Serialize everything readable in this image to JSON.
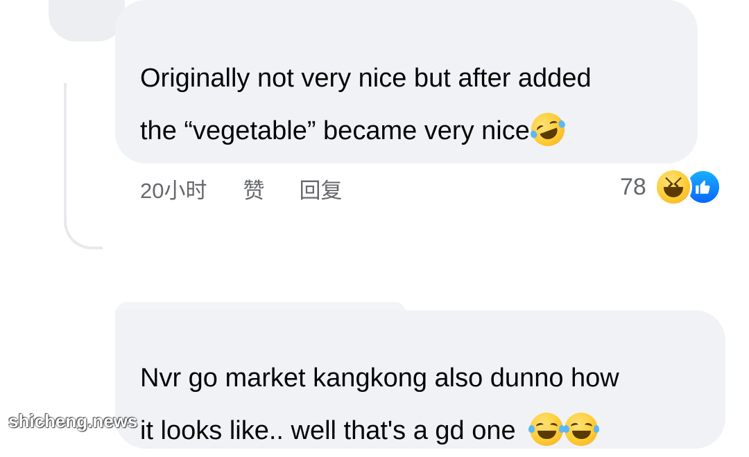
{
  "comments": [
    {
      "lines": [
        "Originally not very nice but after added",
        "the “vegetable” became very nice"
      ],
      "trailing_emoji": "rolling-on-floor-laughing-icon",
      "meta": {
        "time": "20小时",
        "like_label": "赞",
        "reply_label": "回复"
      },
      "reactions": {
        "count": "78",
        "icons": [
          "haha-reaction-icon",
          "like-reaction-icon"
        ]
      }
    },
    {
      "lines": [
        "Nvr go market kangkong also dunno how",
        "it looks like.. well that's a gd one"
      ],
      "trailing_emoji": [
        "tears-of-joy-icon",
        "tears-of-joy-icon"
      ]
    }
  ],
  "watermark": "shicheng.news",
  "colors": {
    "bubble": "#f0f2f5",
    "meta_text": "#65676b",
    "like_blue": "#0866ff",
    "emoji_yellow": "#ffcc33"
  }
}
